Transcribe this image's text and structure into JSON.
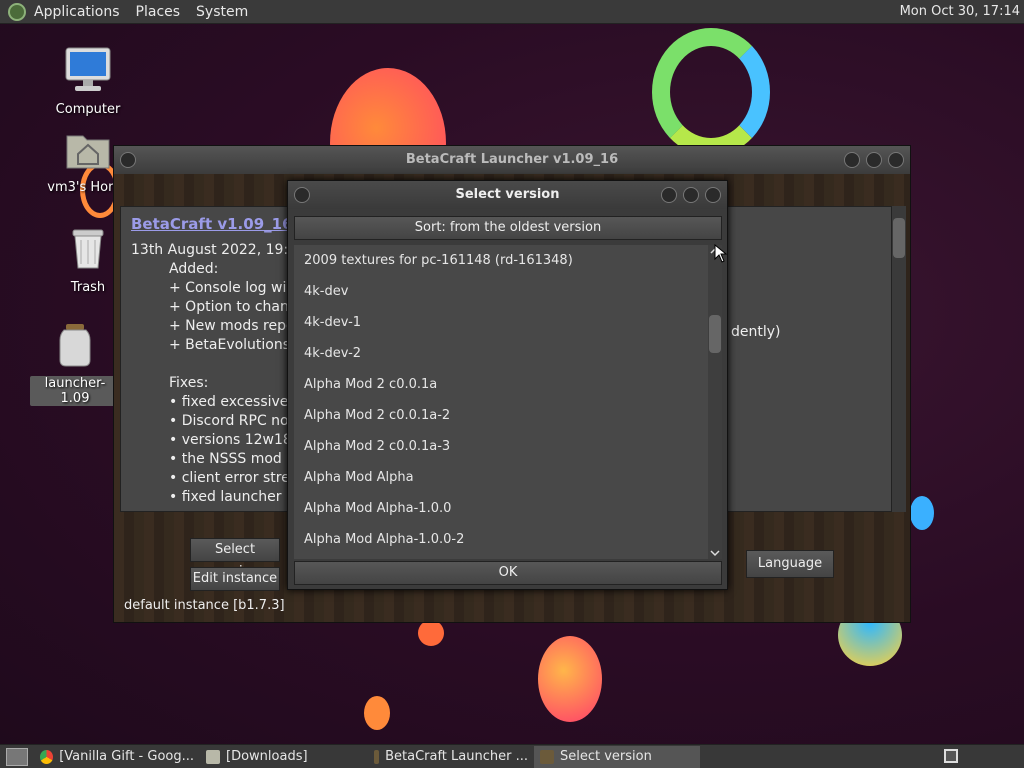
{
  "top_panel": {
    "menus": [
      "Applications",
      "Places",
      "System"
    ],
    "clock": "Mon Oct 30, 17:14"
  },
  "desktop_icons": [
    {
      "label": "Computer",
      "icon": "computer-icon"
    },
    {
      "label": "vm3's Home",
      "icon": "home-folder-icon"
    },
    {
      "label": "Trash",
      "icon": "trash-icon"
    },
    {
      "label": "launcher-1.09",
      "icon": "jar-file-icon"
    }
  ],
  "launcher_window": {
    "title": "BetaCraft Launcher v1.09_16",
    "news_heading": "BetaCraft v1.09_16 (e",
    "news_lines": [
      "13th August 2022, 19:00",
      "Added:",
      "+ Console log wind",
      "+ Option to change",
      "+ New mods repos",
      "+ BetaEvolutions s",
      "",
      "Fixes:",
      "• fixed excessive a",
      "• Discord RPC not",
      "• versions 12w18a",
      "• the NSSS mod s",
      "• client error strean",
      "• fixed launcher no"
    ],
    "news_trailing": "dently)",
    "select_version_label": "Select version",
    "edit_instance_label": "Edit instance",
    "language_label": "Language",
    "instance_status": "default instance [b1.7.3]"
  },
  "dialog": {
    "title": "Select version",
    "sort_label": "Sort: from the oldest version",
    "versions": [
      "2009 textures for pc-161148 (rd-161348)",
      "4k-dev",
      "4k-dev-1",
      "4k-dev-2",
      "Alpha Mod 2 c0.0.1a",
      "Alpha Mod 2 c0.0.1a-2",
      "Alpha Mod 2 c0.0.1a-3",
      "Alpha Mod Alpha",
      "Alpha Mod Alpha-1.0.0",
      "Alpha Mod Alpha-1.0.0-2"
    ],
    "ok_label": "OK"
  },
  "taskbar": {
    "tasks": [
      {
        "label": "[Vanilla Gift - Goog...",
        "active": false
      },
      {
        "label": "[Downloads]",
        "active": false
      },
      {
        "label": "BetaCraft Launcher ...",
        "active": false
      },
      {
        "label": "Select version",
        "active": true
      }
    ]
  }
}
